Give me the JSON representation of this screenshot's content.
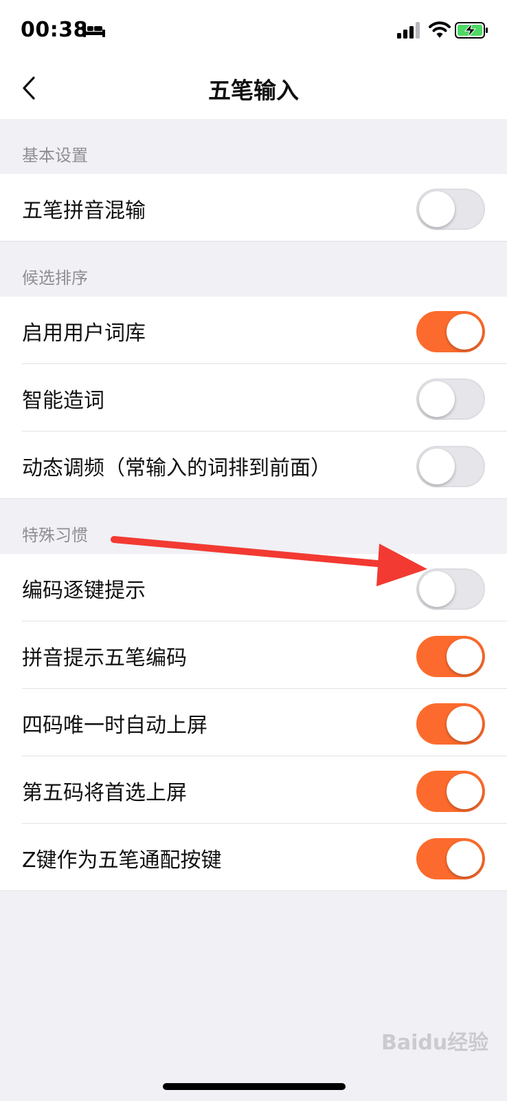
{
  "status": {
    "time": "00:38"
  },
  "nav": {
    "title": "五笔输入"
  },
  "sections": [
    {
      "header": "基本设置",
      "rows": [
        {
          "label": "五笔拼音混输",
          "on": false
        }
      ]
    },
    {
      "header": "候选排序",
      "rows": [
        {
          "label": "启用用户词库",
          "on": true
        },
        {
          "label": "智能造词",
          "on": false
        },
        {
          "label": "动态调频（常输入的词排到前面）",
          "on": false
        }
      ]
    },
    {
      "header": "特殊习惯",
      "rows": [
        {
          "label": "编码逐键提示",
          "on": false
        },
        {
          "label": "拼音提示五笔编码",
          "on": true
        },
        {
          "label": "四码唯一时自动上屏",
          "on": true
        },
        {
          "label": "第五码将首选上屏",
          "on": true
        },
        {
          "label": "Z键作为五笔通配按键",
          "on": true
        }
      ]
    }
  ],
  "watermark": "Baidu经验",
  "colors": {
    "toggle_on": "#fc6b2d",
    "toggle_off": "#e5e5ea",
    "arrow": "#f23a32"
  }
}
